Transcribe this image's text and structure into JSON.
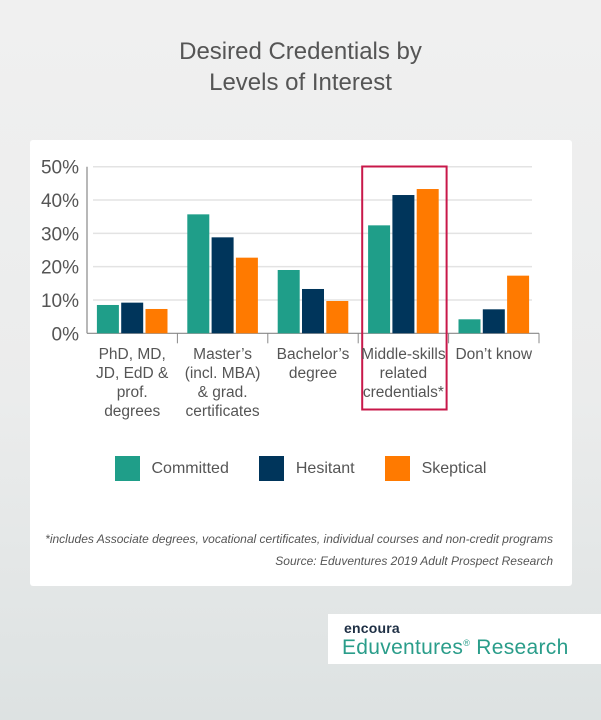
{
  "chart_data": {
    "type": "bar",
    "title": "Desired Credentials by Levels of Interest",
    "title_lines": [
      "Desired Credentials by",
      "Levels of Interest"
    ],
    "xlabel": "",
    "ylabel": "",
    "ylim": [
      0,
      50
    ],
    "yticks": [
      0,
      10,
      20,
      30,
      40,
      50
    ],
    "ytick_labels": [
      "0%",
      "10%",
      "20%",
      "30%",
      "40%",
      "50%"
    ],
    "grid": true,
    "categories": [
      "PhD, MD, JD, EdD & prof. degrees",
      "Master's (incl. MBA) & grad. certificates",
      "Bachelor's degree",
      "Middle-skills related credentials*",
      "Don't know"
    ],
    "category_lines": [
      [
        "PhD, MD,",
        "JD, EdD &",
        "prof.",
        "degrees"
      ],
      [
        "Master’s",
        "(incl. MBA)",
        "& grad.",
        "certificates"
      ],
      [
        "Bachelor’s",
        "degree"
      ],
      [
        "Middle-skills",
        "related",
        "credentials*"
      ],
      [
        "Don’t know"
      ]
    ],
    "highlighted_category": "Middle-skills related credentials*",
    "series": [
      {
        "name": "Committed",
        "color": "#1f9e89",
        "values": [
          8.5,
          35.7,
          19.0,
          32.4,
          4.2
        ]
      },
      {
        "name": "Hesitant",
        "color": "#00355b",
        "values": [
          9.2,
          28.8,
          13.3,
          41.5,
          7.2
        ]
      },
      {
        "name": "Skeptical",
        "color": "#ff7a00",
        "values": [
          7.3,
          22.7,
          9.7,
          43.3,
          17.3
        ]
      }
    ],
    "legend_position": "bottom",
    "highlight_color": "#c8184a",
    "footnote": "*includes Associate degrees, vocational certificates, individual courses and non-credit programs",
    "source": "Source: Eduventures 2019 Adult Prospect Research"
  },
  "branding": {
    "company": "encoura",
    "product": "Eduventures",
    "product_mark": "®",
    "product_suffix": " Research"
  }
}
